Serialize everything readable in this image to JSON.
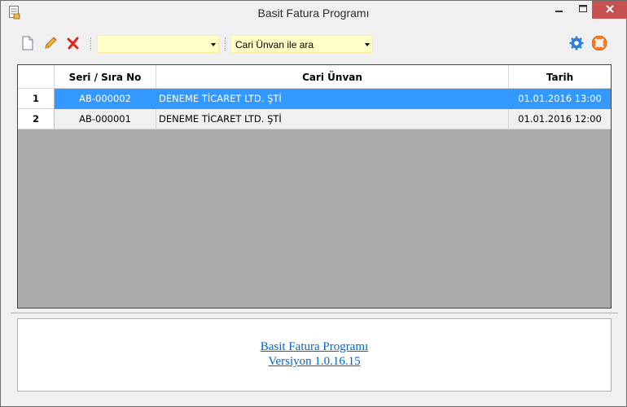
{
  "window": {
    "title": "Basit Fatura Programı"
  },
  "toolbar": {
    "icons": [
      "new-document-icon",
      "pencil-icon",
      "delete-icon",
      "settings-gear-icon",
      "help-lifebuoy-icon"
    ],
    "filter_value": "",
    "search_mode": "Cari Ünvan ile ara"
  },
  "grid": {
    "columns": [
      "Seri / Sıra No",
      "Cari Ünvan",
      "Tarih"
    ],
    "rows": [
      {
        "num": "1",
        "serial": "AB-000002",
        "company": "DENEME TİCARET LTD. ŞTİ",
        "date": "01.01.2016 13:00",
        "selected": true
      },
      {
        "num": "2",
        "serial": "AB-000001",
        "company": "DENEME TİCARET LTD. ŞTİ",
        "date": "01.01.2016 12:00",
        "selected": false
      }
    ]
  },
  "info": {
    "app_name": "Basit Fatura Programı",
    "version": "Versiyon 1.0.16.15"
  },
  "colors": {
    "selection": "#3399ff",
    "combo_background": "#fefec6",
    "grid_background": "#ababab",
    "link": "#0066cc",
    "close_button": "#c75050"
  }
}
